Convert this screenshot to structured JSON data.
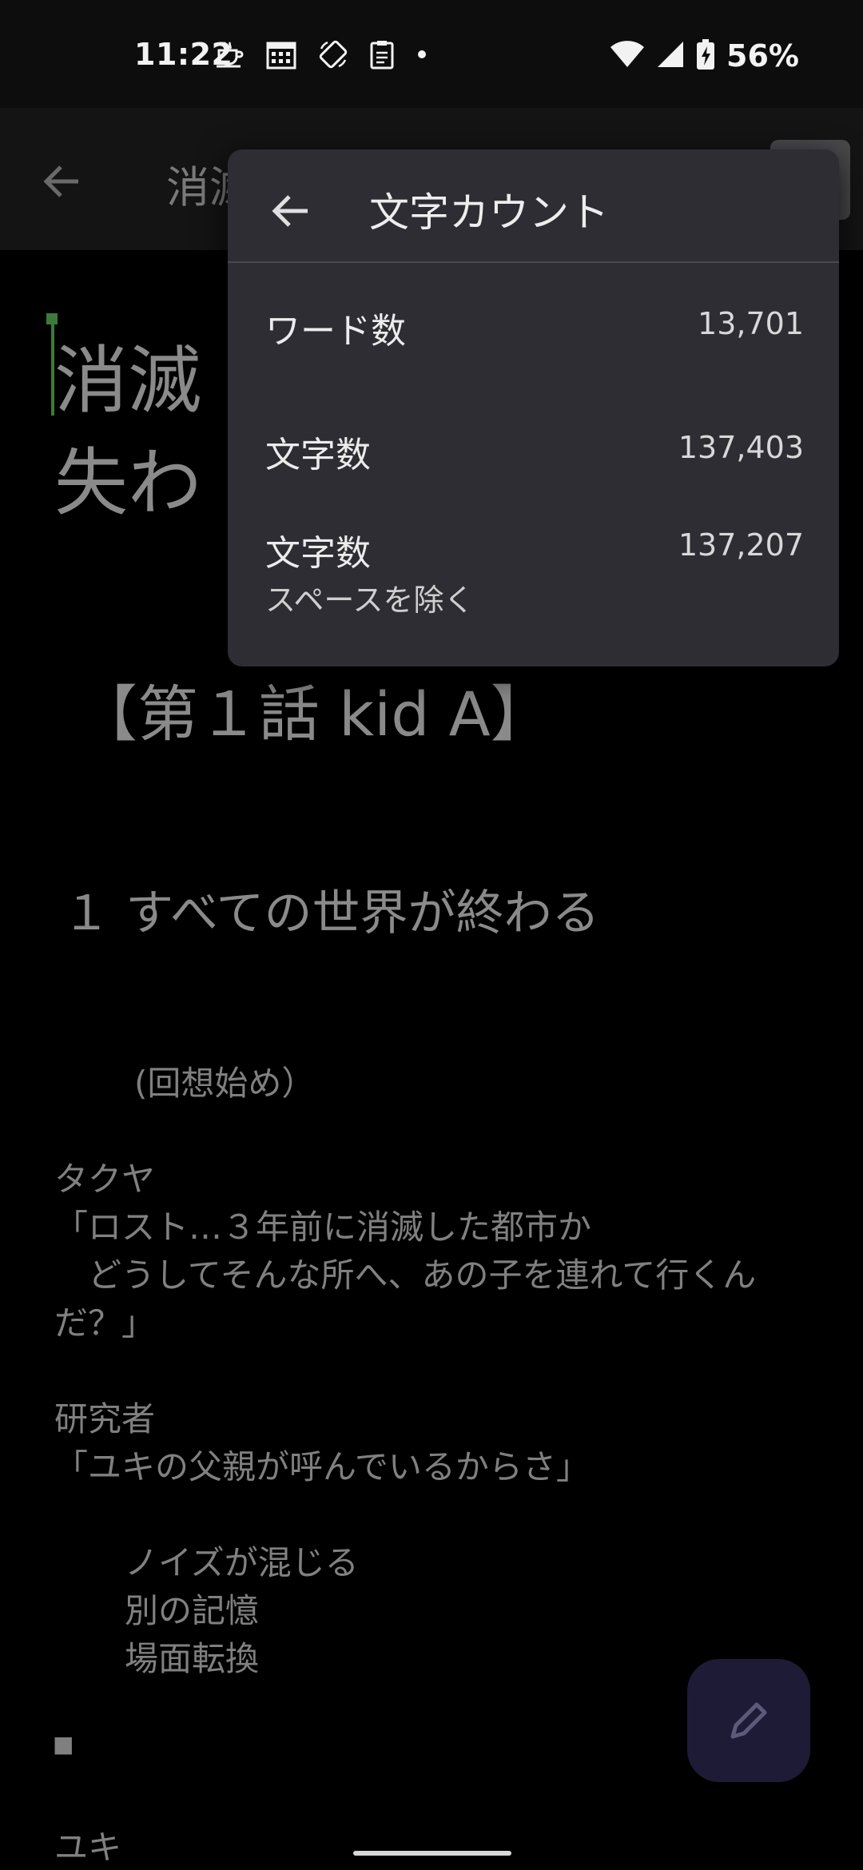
{
  "status_bar": {
    "time": "11:22",
    "battery": "56%",
    "left_icons": [
      "teacup-icon",
      "calendar-icon",
      "rotate-icon",
      "clipboard-icon",
      "dot-icon"
    ],
    "right_icons": [
      "wifi-icon",
      "cellular-signal-icon",
      "battery-charging-icon"
    ]
  },
  "app_bar": {
    "title": "消滅"
  },
  "document": {
    "title_line_1": "消滅",
    "title_line_2": "失わ",
    "heading_1": "【第１話 kid A】",
    "heading_2": "１ すべての世界が終わる",
    "lines": [
      "(回想始め）",
      "タクヤ",
      "「ロスト…３年前に消滅した都市か",
      "　どうしてそんな所へ、あの子を連れて行くん",
      "だ？」",
      "研究者",
      "「ユキの父親が呼んでいるからさ」",
      "ノイズが混じる",
      "別の記憶",
      "場面転換",
      "■",
      "ユキ"
    ]
  },
  "popup": {
    "title": "文字カウント",
    "rows": [
      {
        "label": "ワード数",
        "value": "13,701"
      },
      {
        "label": "文字数",
        "value": "137,403"
      },
      {
        "label": "文字数",
        "sublabel": "スペースを除く",
        "value": "137,207"
      }
    ]
  },
  "colors": {
    "background": "#000000",
    "popup_background": "#2d2d33",
    "fab_background": "#1d1b35",
    "cursor": "#3d7a3a"
  }
}
